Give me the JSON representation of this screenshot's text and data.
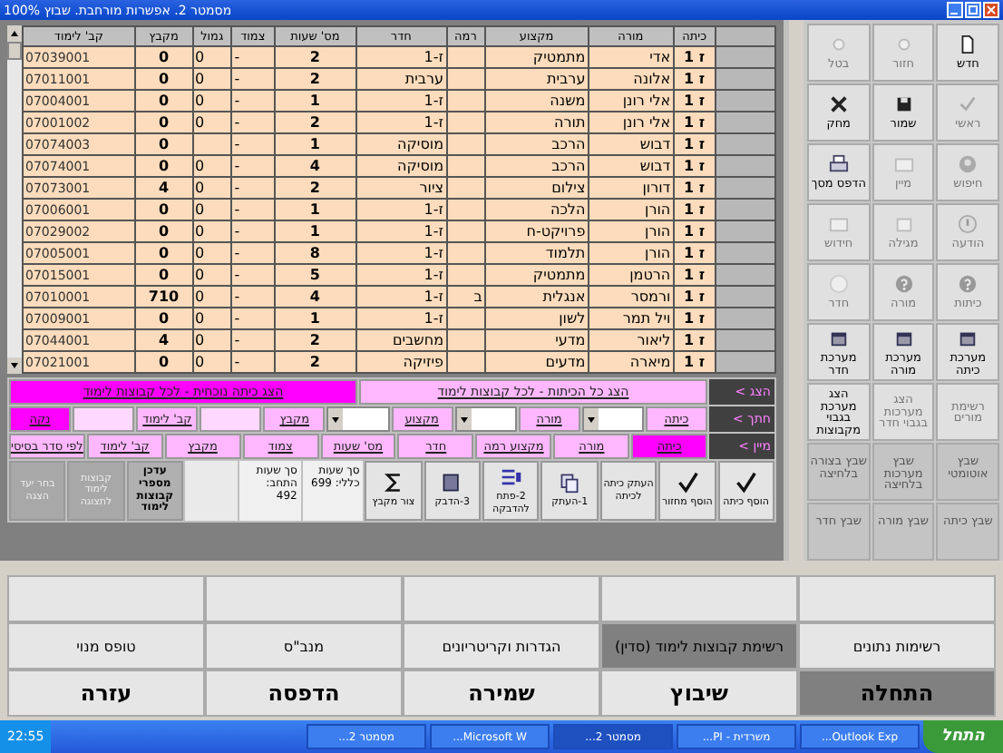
{
  "window": {
    "title": "מסמטר 2. אפשרות מורחבת. שבוץ 100%"
  },
  "toolbar": [
    {
      "label": "חדש",
      "disabled": false
    },
    {
      "label": "חזור",
      "disabled": true
    },
    {
      "label": "בטל",
      "disabled": true
    },
    {
      "label": "ראשי",
      "disabled": true
    },
    {
      "label": "שמור",
      "disabled": false
    },
    {
      "label": "מחק",
      "disabled": false
    },
    {
      "label": "חיפוש",
      "disabled": true
    },
    {
      "label": "מיין",
      "disabled": true
    },
    {
      "label": "הדפס מסך",
      "disabled": false
    },
    {
      "label": "הודעה",
      "disabled": true
    },
    {
      "label": "מגילה",
      "disabled": true
    },
    {
      "label": "חידוש",
      "disabled": true
    },
    {
      "label": "כיתות",
      "disabled": true
    },
    {
      "label": "מורה",
      "disabled": true
    },
    {
      "label": "חדר",
      "disabled": true
    },
    {
      "label": "מערכת כיתה",
      "disabled": false
    },
    {
      "label": "מערכת מורה",
      "disabled": false
    },
    {
      "label": "מערכת חדר",
      "disabled": false
    },
    {
      "label": "רשימת מורים",
      "disabled": true
    },
    {
      "label": "הצג מערכות בגבוי חדר",
      "disabled": true
    },
    {
      "label": "הצג מערכת בגבוי מקבוצות",
      "disabled": false
    },
    {
      "label": "שבץ אוטומטי",
      "disabled": true
    },
    {
      "label": "שבץ מערכות בלחיצה",
      "disabled": true
    },
    {
      "label": "שבץ בצורה בלחיצה",
      "disabled": true
    },
    {
      "label": "שבץ כיתה",
      "disabled": true
    },
    {
      "label": "שבץ מורה",
      "disabled": true
    },
    {
      "label": "שבץ חדר",
      "disabled": true
    }
  ],
  "table": {
    "columns": [
      "כיתה",
      "מורה",
      "מקצוע",
      "רמה",
      "חדר",
      "מס' שעות",
      "צמוד",
      "גמול",
      "מקבץ",
      "קב' לימוד"
    ],
    "rows": [
      [
        "ז 1",
        "אדי",
        "מתמטיק",
        "",
        "ז-1",
        "2",
        "-",
        "0",
        "0",
        "07039001"
      ],
      [
        "ז 1",
        "אלונה",
        "ערבית",
        "",
        "ערבית",
        "2",
        "-",
        "0",
        "0",
        "07011001"
      ],
      [
        "ז 1",
        "אלי רונן",
        "משנה",
        "",
        "ז-1",
        "1",
        "-",
        "0",
        "0",
        "07004001"
      ],
      [
        "ז 1",
        "אלי רונן",
        "תורה",
        "",
        "ז-1",
        "2",
        "-",
        "0",
        "0",
        "07001002"
      ],
      [
        "ז 1",
        "דבוש",
        "הרכב",
        "",
        "מוסיקה",
        "1",
        "-",
        "",
        "0",
        "07074003"
      ],
      [
        "ז 1",
        "דבוש",
        "הרכב",
        "",
        "מוסיקה",
        "4",
        "-",
        "0",
        "0",
        "07074001"
      ],
      [
        "ז 1",
        "דורון",
        "צילום",
        "",
        "ציור",
        "2",
        "-",
        "0",
        "4",
        "07073001"
      ],
      [
        "ז 1",
        "הורן",
        "הלכה",
        "",
        "ז-1",
        "1",
        "-",
        "0",
        "0",
        "07006001"
      ],
      [
        "ז 1",
        "הורן",
        "פרויקט-ח",
        "",
        "ז-1",
        "1",
        "-",
        "0",
        "0",
        "07029002"
      ],
      [
        "ז 1",
        "הורן",
        "תלמוד",
        "",
        "ז-1",
        "8",
        "-",
        "0",
        "0",
        "07005001"
      ],
      [
        "ז 1",
        "הרטמן",
        "מתמטיק",
        "",
        "ז-1",
        "5",
        "-",
        "0",
        "0",
        "07015001"
      ],
      [
        "ז 1",
        "ורמסר",
        "אנגלית",
        "ב",
        "ז-1",
        "4",
        "-",
        "0",
        "710",
        "07010001"
      ],
      [
        "ז 1",
        "ויל תמר",
        "לשון",
        "",
        "ז-1",
        "1",
        "-",
        "0",
        "0",
        "07009001"
      ],
      [
        "ז 1",
        "ליאור",
        "מדעי",
        "",
        "מחשבים",
        "2",
        "-",
        "0",
        "4",
        "07044001"
      ],
      [
        "ז 1",
        "מיארה",
        "מדעים",
        "",
        "פיזיקה",
        "2",
        "-",
        "0",
        "0",
        "07021001"
      ]
    ]
  },
  "panel": [
    {
      "label": "הצג >",
      "cells": [
        {
          "kind": "button",
          "label": "הצג כל הכיתות - לכל קבוצות לימוד",
          "selected": false
        },
        {
          "kind": "button",
          "label": "הצג כיתה נוכחית - לכל קבוצות לימוד",
          "selected": true
        }
      ]
    },
    {
      "label": "חתך >",
      "cells": [
        {
          "kind": "button",
          "label": "כיתה",
          "selected": false
        },
        {
          "kind": "combo"
        },
        {
          "kind": "button",
          "label": "מורה",
          "selected": false
        },
        {
          "kind": "combo"
        },
        {
          "kind": "button",
          "label": "מקצוע",
          "selected": false
        },
        {
          "kind": "combo"
        },
        {
          "kind": "button",
          "label": "מקבץ",
          "selected": false
        },
        {
          "kind": "field"
        },
        {
          "kind": "button",
          "label": "קב' לימוד",
          "selected": false
        },
        {
          "kind": "field"
        },
        {
          "kind": "button",
          "label": "נקה",
          "selected": true
        }
      ]
    },
    {
      "label": "מיין >",
      "cells": [
        {
          "kind": "button",
          "label": "כיתה",
          "selected": true
        },
        {
          "kind": "button",
          "label": "מורה",
          "selected": false
        },
        {
          "kind": "button",
          "label": "מקצוע רמה",
          "selected": false
        },
        {
          "kind": "button",
          "label": "חדר",
          "selected": false
        },
        {
          "kind": "button",
          "label": "מס' שעות",
          "selected": false
        },
        {
          "kind": "button",
          "label": "צמוד",
          "selected": false
        },
        {
          "kind": "button",
          "label": "מקבץ",
          "selected": false
        },
        {
          "kind": "button",
          "label": "קב' לימוד",
          "selected": false
        },
        {
          "kind": "button",
          "label": "לפי סדר בסיסי",
          "selected": false
        }
      ]
    }
  ],
  "actions": [
    {
      "kind": "button",
      "label": "הוסף כיתה",
      "disabled": false
    },
    {
      "kind": "button",
      "label": "הוסף מחזור",
      "disabled": false
    },
    {
      "kind": "button",
      "label": "העתק כיתה לכיתה",
      "disabled": false
    },
    {
      "kind": "button",
      "label": "1-העתק",
      "disabled": false
    },
    {
      "kind": "button",
      "label": "2-פתח להדבקה",
      "disabled": false
    },
    {
      "kind": "button",
      "label": "3-הדבק",
      "disabled": false
    },
    {
      "kind": "button",
      "label": "צור מקבץ",
      "disabled": false
    },
    {
      "kind": "info",
      "label": "סך שעות כללי: 699"
    },
    {
      "kind": "info",
      "label": "סך שעות התחב: 492"
    },
    {
      "kind": "blank"
    },
    {
      "kind": "button",
      "label": "עדכן מספרי קבוצות לימוד",
      "disabled": false
    },
    {
      "kind": "button",
      "label": "קבוצות לימוד לתצוגה",
      "disabled": true
    },
    {
      "kind": "button",
      "label": "בחר יעד הצגה",
      "disabled": true
    }
  ],
  "nav_rows": [
    [
      {
        "label": "רשימות נתונים",
        "selected": false
      },
      {
        "label": "רשימת קבוצות לימוד (סדין)",
        "selected": true
      },
      {
        "label": "הגדרות וקריטריונים",
        "selected": false
      },
      {
        "label": "מנב\"ס",
        "selected": false
      },
      {
        "label": "טופס מנוי",
        "selected": false
      }
    ],
    [
      {
        "label": "התחלה",
        "selected": true
      },
      {
        "label": "שיבוץ",
        "selected": false
      },
      {
        "label": "שמירה",
        "selected": false
      },
      {
        "label": "הדפסה",
        "selected": false
      },
      {
        "label": "עזרה",
        "selected": false
      }
    ]
  ],
  "taskbar": {
    "start": "התחל",
    "tasks": [
      {
        "label": "Outlook Exp...",
        "selected": false
      },
      {
        "label": "משרדית - PI...",
        "selected": false
      },
      {
        "label": "מסמטר 2...",
        "selected": true
      },
      {
        "label": "Microsoft W...",
        "selected": false
      },
      {
        "label": "מסמטר 2...",
        "selected": false
      }
    ],
    "clock": "22:55"
  }
}
